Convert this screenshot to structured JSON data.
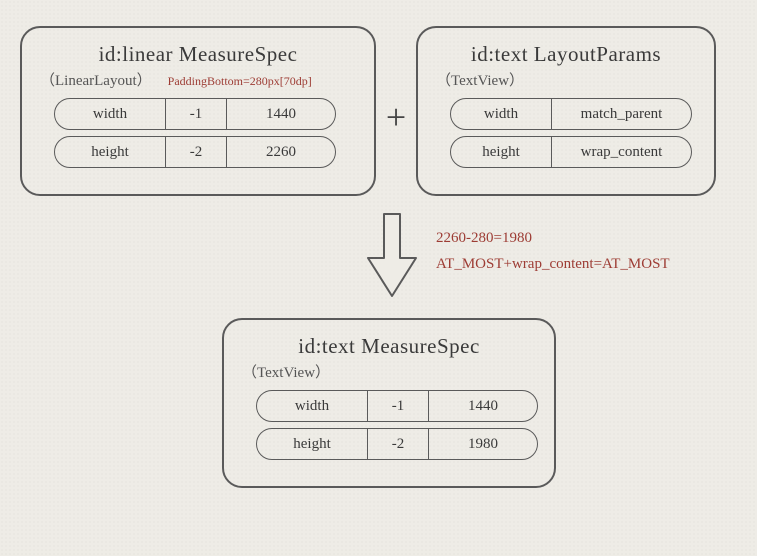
{
  "linear": {
    "title": "id:linear MeasureSpec",
    "subtitle": "（LinearLayout）",
    "annotation": "PaddingBottom=280px[70dp]",
    "width": {
      "label": "width",
      "mode": "-1",
      "value": "1440"
    },
    "height": {
      "label": "height",
      "mode": "-2",
      "value": "2260"
    }
  },
  "plus": "+",
  "textParams": {
    "title": "id:text  LayoutParams",
    "subtitle": "（TextView）",
    "width": {
      "label": "width",
      "value": "match_parent"
    },
    "height": {
      "label": "height",
      "value": "wrap_content"
    }
  },
  "notes": {
    "line1": "2260-280=1980",
    "line2": "AT_MOST+wrap_content=AT_MOST"
  },
  "result": {
    "title": "id:text  MeasureSpec",
    "subtitle": "（TextView）",
    "width": {
      "label": "width",
      "mode": "-1",
      "value": "1440"
    },
    "height": {
      "label": "height",
      "mode": "-2",
      "value": "1980"
    }
  }
}
